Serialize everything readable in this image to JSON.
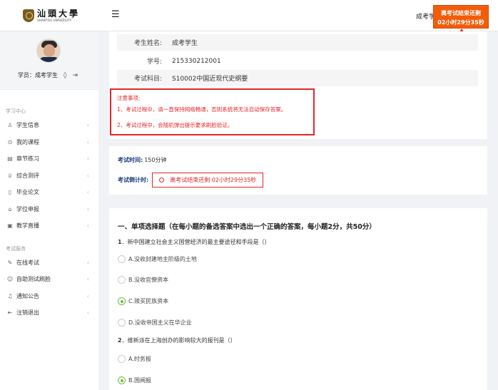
{
  "header": {
    "logo_cn": "汕頭大學",
    "logo_en": "SHANTOU UNIVERSITY",
    "menu_icon": "hamburger-icon",
    "user_name": "成考学",
    "countdown_line1": "离考试结束还剩",
    "countdown_line2": "02小时29分35秒"
  },
  "sidebar": {
    "user_label": "学员：成考学生",
    "study_section": "学习中心",
    "study_items": [
      {
        "label": "学生信息",
        "icon": "user-icon"
      },
      {
        "label": "我的课程",
        "icon": "course-icon"
      },
      {
        "label": "章节练习",
        "icon": "book-icon"
      },
      {
        "label": "综合测评",
        "icon": "trophy-icon"
      },
      {
        "label": "毕业论文",
        "icon": "document-icon"
      },
      {
        "label": "学位申报",
        "icon": "degree-icon"
      },
      {
        "label": "教学直播",
        "icon": "live-icon"
      }
    ],
    "exam_section": "考试服务",
    "exam_items": [
      {
        "label": "在线考试",
        "icon": "exam-icon"
      },
      {
        "label": "自助测试刷脸",
        "icon": "face-icon"
      },
      {
        "label": "通知公告",
        "icon": "bell-icon"
      },
      {
        "label": "注销退出",
        "icon": "logout-icon"
      }
    ]
  },
  "exam_info": {
    "name_label": "考生姓名:",
    "name_value": "成考学生",
    "id_label": "学号:",
    "id_value": "215330212001",
    "subject_label": "考试科目:",
    "subject_value": "S10002中国近现代史纲要"
  },
  "notice": {
    "title": "注意事项:",
    "line1": "1、考试过程中，请一直保持网络畅通，否则系统将无法自动保存答案。",
    "line2": "2、考试过程中，会随机弹出提示要求刷脸验证。"
  },
  "timing": {
    "time_label": "考试时间:",
    "time_value": "150分钟",
    "countdown_label": "考试倒计时:",
    "countdown_value": "离考试结束还剩 02小时29分35秒"
  },
  "questions": {
    "section_title": "一、单项选择题（在每小题的备选答案中选出一个正确的答案，每小题2分，共50分）",
    "q1_num": "1",
    "q1_text": "新中国建立社会主义国营经济的最主要途径和手段是（）",
    "q1_options": [
      "A.没收封建地主阶级的土地",
      "B.没收官僚资本",
      "C.赎买民族资本",
      "D.没收帝国主义在华企业"
    ],
    "q1_selected": 2,
    "q2_num": "2",
    "q2_text": "维新派在上海创办的影响较大的报刊是（）",
    "q2_options": [
      "A.时务报",
      "B.国闻报"
    ],
    "q2_selected": 1
  }
}
